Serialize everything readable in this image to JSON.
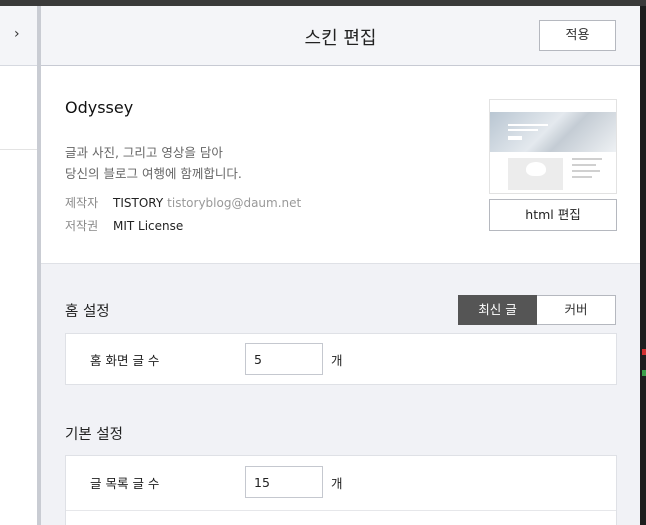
{
  "window": {
    "title": "스킨 편집",
    "apply_label": "적용"
  },
  "left_panel": {
    "collapse_icon": "chevron-right-icon",
    "collapse_glyph": "›"
  },
  "skin": {
    "name": "Odyssey",
    "description_line1": "글과 사진, 그리고 영상을 담아",
    "description_line2": "당신의 블로그 여행에 함께합니다.",
    "maker_label": "제작자",
    "maker_name": "TISTORY",
    "maker_email": "tistoryblog@daum.net",
    "license_label": "저작권",
    "license_value": "MIT License",
    "html_edit_label": "html 편집"
  },
  "home_settings": {
    "title": "홈 설정",
    "tabs": [
      {
        "label": "최신 글",
        "active": true
      },
      {
        "label": "커버",
        "active": false
      }
    ],
    "post_count_label": "홈 화면 글 수",
    "post_count_value": "5",
    "unit": "개"
  },
  "basic_settings": {
    "title": "기본 설정",
    "list_count_label": "글 목록 글 수",
    "list_count_value": "15",
    "unit": "개"
  },
  "colors": {
    "panel_bg": "#f1f2f6",
    "active_tab_bg": "#555555",
    "border": "#b5b8bf"
  }
}
